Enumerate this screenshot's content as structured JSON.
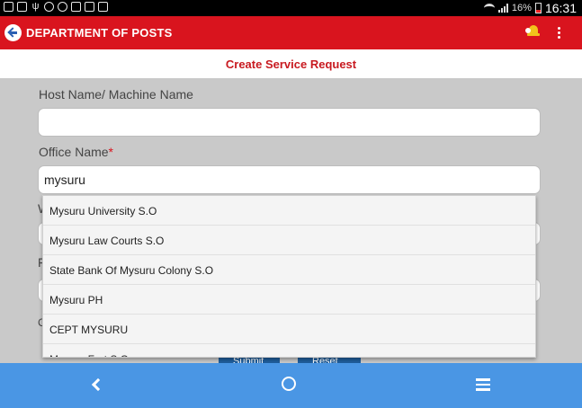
{
  "status_bar": {
    "battery_text": "16%",
    "time": "16:31"
  },
  "app_bar": {
    "title": "DEPARTMENT OF POSTS"
  },
  "sub_header": {
    "title": "Create Service Request"
  },
  "form": {
    "host_name_label": "Host Name/ Machine Name",
    "host_name_value": "",
    "office_name_label": "Office Name",
    "office_name_required_mark": "*",
    "office_name_value": "mysuru"
  },
  "autocomplete": {
    "items": [
      "Mysuru University S.O",
      "Mysuru Law Courts S.O",
      "State Bank Of Mysuru Colony S.O",
      "Mysuru PH",
      "CEPT MYSURU",
      "Mysuru Fort S.O"
    ]
  },
  "buttons": {
    "submit_label": "Submit",
    "reset_label": "Reset"
  },
  "icons": {
    "app_back": "back-arrow-circle-icon",
    "notification": "bell-icon",
    "overflow": "more-vert-icon",
    "nav_back": "chevron-left-icon",
    "nav_home": "circle-home-icon",
    "nav_menu": "hamburger-menu-icon"
  },
  "colors": {
    "app_bar": "#d9141e",
    "nav_bar": "#4a96e4",
    "background": "#c9c9c9",
    "sub_header_text": "#c81a20"
  }
}
